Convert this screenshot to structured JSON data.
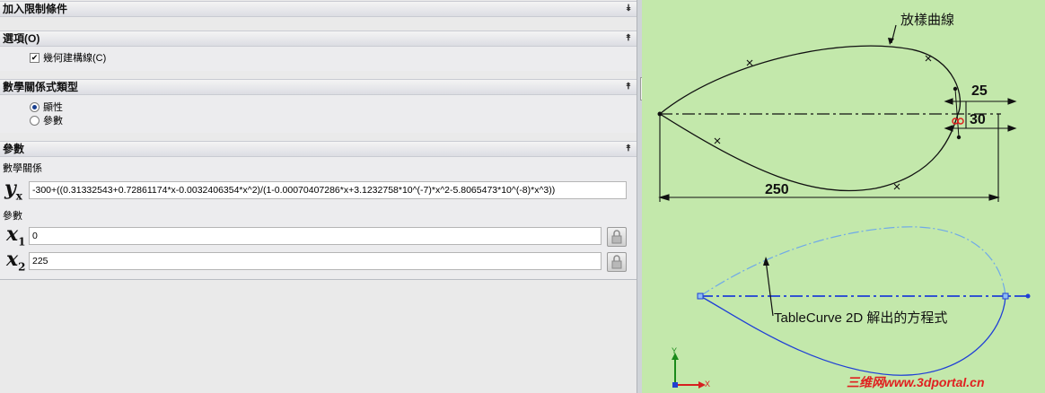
{
  "panel": {
    "constraints": {
      "title": "加入限制條件"
    },
    "options": {
      "title": "選項(O)",
      "construction_checkbox": "幾何建構線(C)",
      "construction_checked": true
    },
    "equation_type": {
      "title": "數學關係式類型",
      "explicit": "顯性",
      "parametric": "參數",
      "selected": "explicit"
    },
    "parameters": {
      "title": "參數",
      "equation_label": "數學關係",
      "y_symbol": "y",
      "y_sub": "x",
      "equation_value": "-300+((0.31332543+0.72861174*x-0.0032406354*x^2)/(1-0.00070407286*x+3.1232758*10^(-7)*x^2-5.8065473*10^(-8)*x^3))",
      "params_label": "參數",
      "x_symbol": "x",
      "x1_sub": "1",
      "x2_sub": "2",
      "x1_value": "0",
      "x2_value": "225"
    }
  },
  "graphics": {
    "spline_label": "放樣曲線",
    "dim_25": "25",
    "dim_30": "30",
    "dim_250": "250",
    "tablecurve_label": "TableCurve 2D 解出的方程式",
    "axis_y": "Y",
    "axis_x": "X",
    "watermark": "三维网www.3dportal.cn"
  },
  "colors": {
    "graphics_bg": "#c3e8ab",
    "curve_blue": "#1f3fd6",
    "curve_light": "#6fa9e8"
  }
}
